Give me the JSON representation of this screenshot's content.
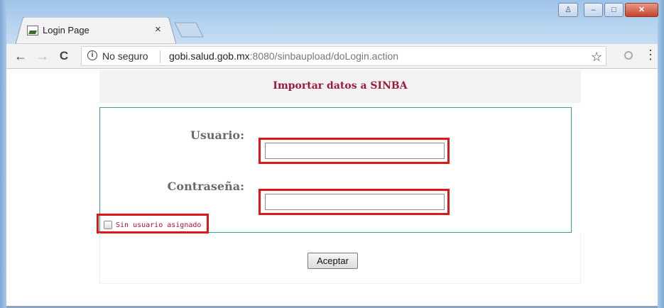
{
  "browser": {
    "tab": {
      "title": "Login Page",
      "close_glyph": "×"
    },
    "window_controls": {
      "user": "♙",
      "minimize": "–",
      "maximize": "□",
      "close": "✕"
    },
    "nav": {
      "back": "←",
      "forward": "→",
      "reload": "C"
    },
    "address_bar": {
      "security_label": "No seguro",
      "url_host": "gobi.salud.gob.mx",
      "url_rest": ":8080/sinbaupload/doLogin.action"
    },
    "icons": {
      "bookmark": "☆",
      "menu": "⋮",
      "info": "i"
    }
  },
  "page": {
    "title": "Importar datos a SINBA",
    "username_label": "Usuario:",
    "username_value": "",
    "password_label": "Contraseña:",
    "password_value": "",
    "checkbox_label": "Sin usuario asignado",
    "submit_label": "Aceptar"
  },
  "colors": {
    "title": "#a0193c",
    "highlight": "#dc1818",
    "form_border": "#33a39a",
    "label": "#6a6a6a"
  }
}
